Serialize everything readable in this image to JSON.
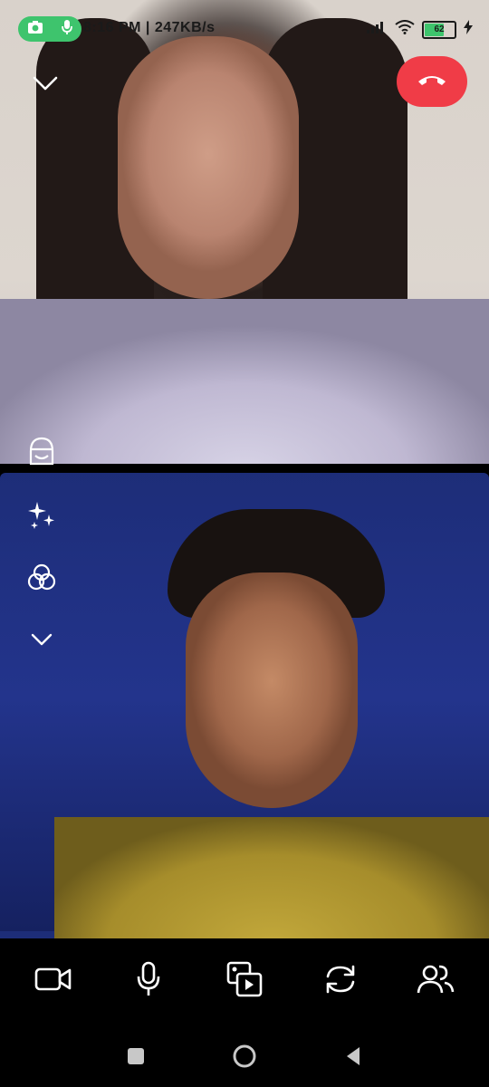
{
  "status_bar": {
    "time": "8:16 PM | 247KB/s",
    "battery": "62",
    "recording_indicator": [
      "camera-icon",
      "mic-icon"
    ],
    "recording_color": "#3ec46d"
  },
  "call": {
    "end_call_color": "#f03c47",
    "participants": [
      {
        "role": "remote",
        "feed": "video-feed"
      },
      {
        "role": "self",
        "feed": "video-feed"
      }
    ]
  },
  "side_tools": [
    "face-filter-icon",
    "effects-sparkle-icon",
    "color-filter-icon",
    "chevron-down-icon"
  ],
  "controls": [
    "video-camera-icon",
    "microphone-icon",
    "media-share-icon",
    "switch-camera-icon",
    "participants-icon"
  ],
  "navbar": [
    "recents-square-icon",
    "home-circle-icon",
    "back-triangle-icon"
  ]
}
